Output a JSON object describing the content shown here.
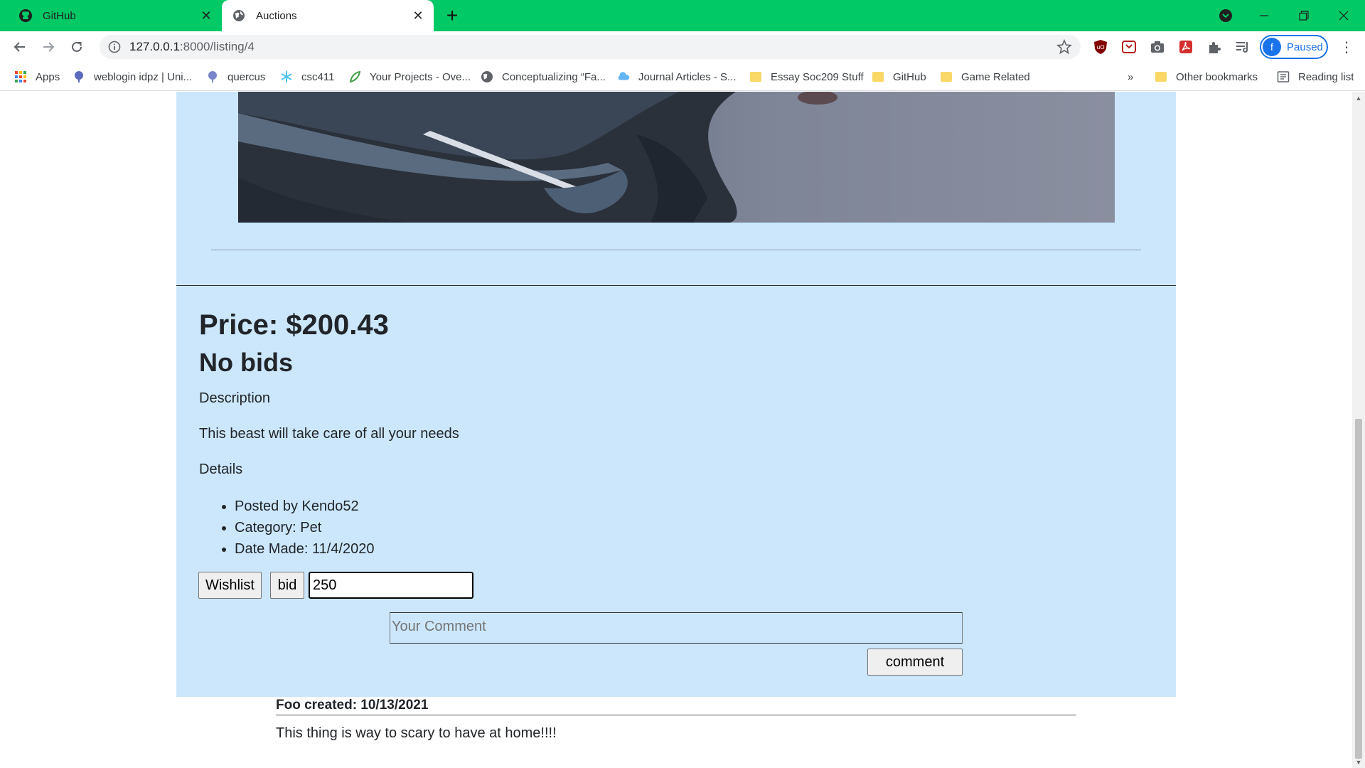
{
  "browser": {
    "tabs": [
      {
        "title": "GitHub",
        "icon": "github-icon"
      },
      {
        "title": "Auctions",
        "icon": "globe-icon"
      }
    ],
    "url_host": "127.0.0.1",
    "url_path": ":8000/listing/4",
    "profile_initial": "f",
    "profile_status": "Paused",
    "bookmarks": [
      {
        "label": "Apps"
      },
      {
        "label": "weblogin idpz | Uni..."
      },
      {
        "label": "quercus"
      },
      {
        "label": "csc411"
      },
      {
        "label": "Your Projects - Ove..."
      },
      {
        "label": "Conceptualizing “Fa..."
      },
      {
        "label": "Journal Articles - S..."
      },
      {
        "label": "Essay Soc209 Stuff"
      },
      {
        "label": "GitHub"
      },
      {
        "label": "Game Related"
      }
    ],
    "overflow": "»",
    "other_bookmarks": "Other bookmarks",
    "reading_list": "Reading list",
    "accent": "#00c965"
  },
  "listing": {
    "price": "Price: $200.43",
    "bids": "No bids",
    "description_heading": "Description",
    "description": "This beast will take care of all your needs",
    "details_heading": "Details",
    "details": [
      "Posted by Kendo52",
      "Category: Pet",
      "Date Made: 11/4/2020"
    ],
    "wishlist_label": "Wishlist",
    "bid_label": "bid",
    "bid_value": "250",
    "comment_placeholder": "Your Comment",
    "comment_button": "comment",
    "background": "#cce7fc"
  },
  "comments": [
    {
      "header": "Foo created: 10/13/2021",
      "text": "This thing is way to scary to have at home!!!!"
    }
  ]
}
